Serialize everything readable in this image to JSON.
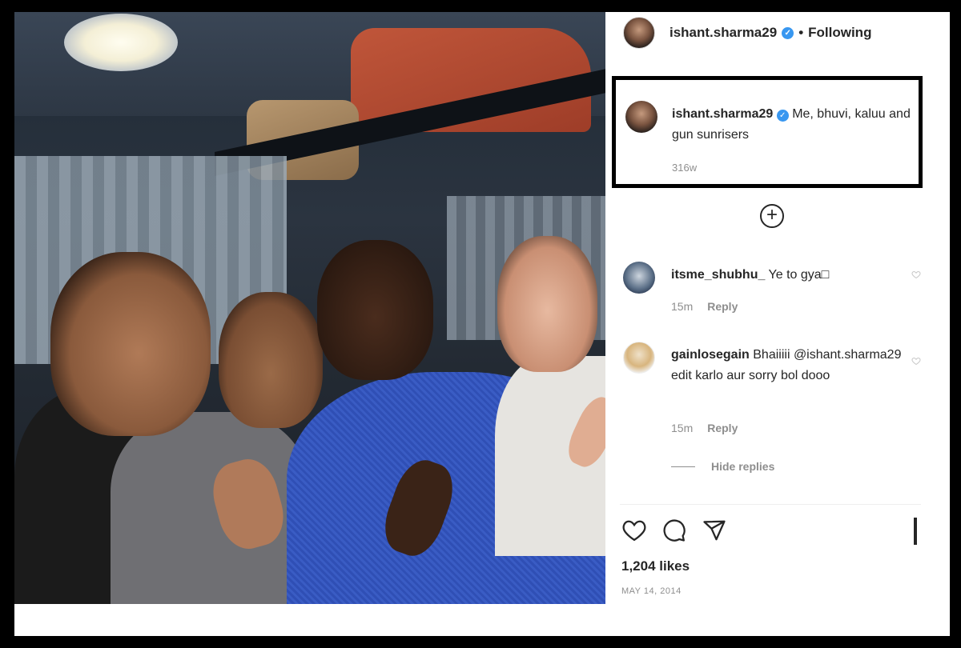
{
  "post": {
    "username": "ishant.sharma29",
    "verified_mark": "✓",
    "separator": "•",
    "follow_status": "Following",
    "photo_alt": "photo"
  },
  "caption": {
    "username": "ishant.sharma29",
    "text": "Me, bhuvi, kaluu and gun sunrisers",
    "time": "316w"
  },
  "add_comment_icon": "+",
  "comments": [
    {
      "username": "itsme_shubhu_",
      "text": "Ye to gya□",
      "time": "15m",
      "reply_label": "Reply"
    },
    {
      "username": "gainlosegain",
      "text": "Bhaiiiii @ishant.sharma29 edit karlo aur sorry bol dooo",
      "time": "15m",
      "reply_label": "Reply"
    }
  ],
  "hide_replies_label": "Hide replies",
  "actions": {
    "like_icon": "heart-icon",
    "comment_icon": "comment-icon",
    "share_icon": "share-icon"
  },
  "likes": "1,204 likes",
  "date": "MAY 14, 2014",
  "colors": {
    "verified_blue": "#3897f0",
    "muted_text": "#8e8e8e",
    "highlight_border": "#000000"
  }
}
